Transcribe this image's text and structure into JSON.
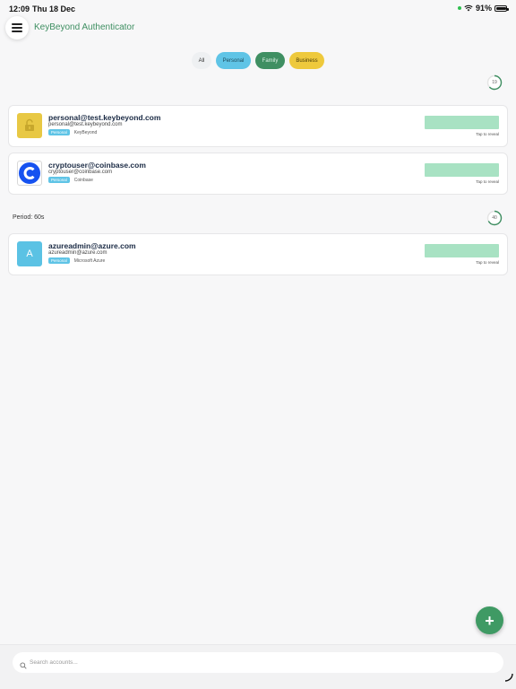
{
  "status_bar": {
    "time": "12:09",
    "date": "Thu 18 Dec",
    "battery": "91%",
    "battery_level": 0.91
  },
  "header": {
    "title": "KeyBeyond Authenticator"
  },
  "filters": [
    "All",
    "Personal",
    "Family",
    "Business"
  ],
  "colors": {
    "accent_green": "#3f8f62",
    "personal": "#5fc4e6",
    "family": "#3f8f62",
    "business": "#eec93c",
    "code_placeholder": "#a8e2c3"
  },
  "timers": [
    {
      "value": "19",
      "fraction": 0.63
    },
    {
      "value": "40",
      "fraction": 0.67
    }
  ],
  "accounts": [
    {
      "title": "personal@test.keybeyond.com",
      "subtitle": "personal@test.keybeyond.com",
      "tag": "Personal",
      "issuer": "KeyBeyond",
      "icon": "lock-icon",
      "reveal": "Tap to reveal"
    },
    {
      "title": "cryptouser@coinbase.com",
      "subtitle": "cryptouser@coinbase.com",
      "tag": "Personal",
      "issuer": "Coinbase",
      "icon": "coinbase-logo-icon",
      "reveal": "Tap to reveal"
    },
    {
      "title": "azureadmin@azure.com",
      "subtitle": "azureadmin@azure.com",
      "tag": "Personal",
      "issuer": "Microsoft Azure",
      "icon": "letter-a-icon",
      "letter": "A",
      "reveal": "Tap to reveal"
    }
  ],
  "section": {
    "period_label": "Period: 60s"
  },
  "fab": {
    "label": "+"
  },
  "search": {
    "placeholder": "Search accounts...",
    "value": ""
  }
}
